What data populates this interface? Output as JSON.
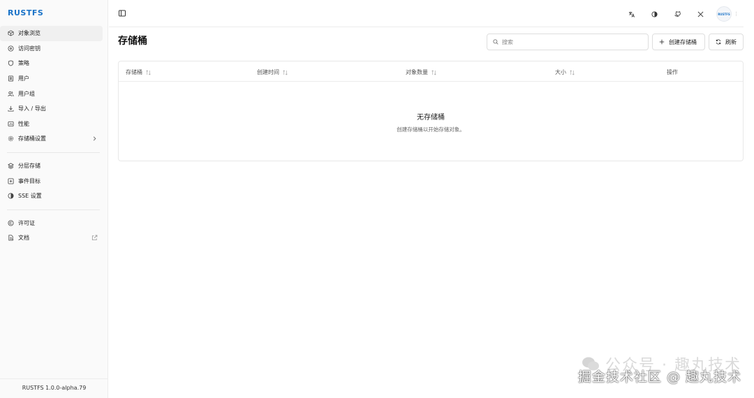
{
  "app": {
    "logo": "RUSTFS",
    "version": "RUSTFS 1.0.0-alpha.79"
  },
  "sidebar": {
    "group1": [
      {
        "label": "对象浏览",
        "icon": "box-icon",
        "active": true
      },
      {
        "label": "访问密钥",
        "icon": "key-icon"
      },
      {
        "label": "策略",
        "icon": "shield-icon"
      },
      {
        "label": "用户",
        "icon": "user-card-icon"
      },
      {
        "label": "用户组",
        "icon": "users-icon"
      },
      {
        "label": "导入 / 导出",
        "icon": "download-icon"
      },
      {
        "label": "性能",
        "icon": "monitor-icon"
      },
      {
        "label": "存储桶设置",
        "icon": "settings-icon",
        "chevron": true
      }
    ],
    "group2": [
      {
        "label": "分层存储",
        "icon": "layers-icon"
      },
      {
        "label": "事件目标",
        "icon": "target-icon"
      },
      {
        "label": "SSE 设置",
        "icon": "lock-icon"
      }
    ],
    "group3": [
      {
        "label": "许可证",
        "icon": "copyright-icon"
      },
      {
        "label": "文档",
        "icon": "document-icon",
        "external": true
      }
    ]
  },
  "header": {
    "icons": [
      "translate-icon",
      "theme-icon",
      "github-icon",
      "x-icon"
    ],
    "avatar_text": "RUSTFS"
  },
  "main": {
    "title": "存储桶",
    "search_placeholder": "搜索",
    "create_button": "创建存储桶",
    "refresh_button": "刷新",
    "columns": [
      "存储桶",
      "创建时间",
      "对象数量",
      "大小",
      "操作"
    ],
    "empty_title": "无存储桶",
    "empty_desc": "创建存储桶以开始存储对象。"
  },
  "watermark": {
    "line1": "公众号 · 趣丸技术",
    "line2": "掘金技术社区 @ 趣丸技术"
  }
}
